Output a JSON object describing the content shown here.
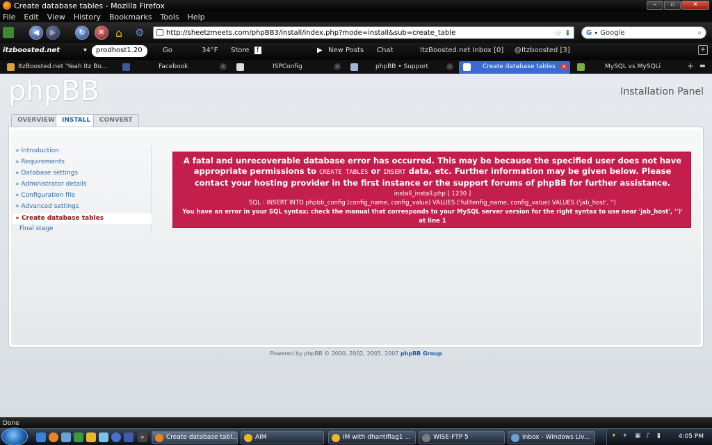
{
  "window": {
    "title": "Create database tables - Mozilla Firefox"
  },
  "menu": [
    "File",
    "Edit",
    "View",
    "History",
    "Bookmarks",
    "Tools",
    "Help"
  ],
  "nav": {
    "url": "http://sheetzmeets.com/phpBB3/install/index.php?mode=install&sub=create_table",
    "search_placeholder": "Google"
  },
  "toolbar": {
    "server": "prodhost1.20",
    "go": "Go",
    "weather": "34°F",
    "store": "Store",
    "new_posts": "New Posts",
    "chat": "Chat",
    "inbox": "ItzBoosted.net Inbox [0]",
    "twitter": "@Itzboosted [3]"
  },
  "tabs": [
    {
      "label": "ItzBoosted.net 'Yeah Itz Bo...",
      "active": false
    },
    {
      "label": "Facebook",
      "active": false
    },
    {
      "label": "ISPConfig",
      "active": false
    },
    {
      "label": "phpBB • Support",
      "active": false
    },
    {
      "label": "Create database tables",
      "active": true
    },
    {
      "label": "MySQL vs MySQLi",
      "active": false
    }
  ],
  "page": {
    "logo": "phpBB",
    "panel_title": "Installation Panel",
    "install_tabs": [
      "OVERVIEW",
      "INSTALL",
      "CONVERT"
    ],
    "sidebar": [
      "Introduction",
      "Requirements",
      "Database settings",
      "Administrator details",
      "Configuration file",
      "Advanced settings",
      "Create database tables",
      "Final stage"
    ],
    "error": {
      "msg_a": "A fatal and unrecoverable database error has occurred. This may be because the specified user does not have appropriate permissions to ",
      "kw1": "CREATE TABLES",
      "msg_or": " or ",
      "kw2": "INSERT",
      "msg_b": " data, etc. Further information may be given below. Please contact your hosting provider in the first instance or the support forums of phpBB for further assistance.",
      "file": "install_install.php [ 1230 ]",
      "sql": "SQL : INSERT INTO phpbb_config (config_name, config_value) VALUES ('fulltenfig_name, config_value) VALUES ('jab_host', '')",
      "mysql": "You have an error in your SQL syntax; check the manual that corresponds to your MySQL server version for the right syntax to use near 'jab_host', '')' at line 1"
    },
    "footer_text": "Powered by phpBB © 2000, 2002, 2005, 2007 ",
    "footer_link": "phpBB Group"
  },
  "status": "Done",
  "taskbar": {
    "tasks": [
      "Create database tabl...",
      "AIM",
      "IM with dhantiflag1 ...",
      "WISE-FTP 5",
      "Inbox - Windows Liv..."
    ],
    "clock": "4:05 PM"
  }
}
